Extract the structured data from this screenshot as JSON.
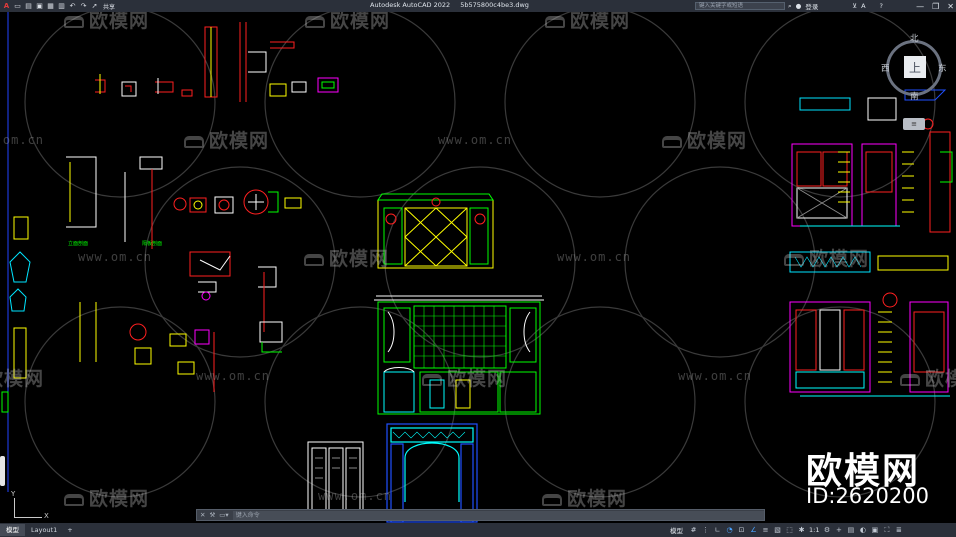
{
  "app": {
    "title": "Autodesk AutoCAD 2022",
    "filename": "5b575800c4be3.dwg",
    "share_label": "共享",
    "search_placeholder": "键入关键字或短语",
    "login_label": "登录"
  },
  "quick_access": [
    "new-icon",
    "open-icon",
    "save-icon",
    "saveas-icon",
    "print-icon",
    "undo-icon",
    "redo-icon",
    "share-icon"
  ],
  "viewcube": {
    "top": "上",
    "north": "北",
    "south": "南",
    "east": "东",
    "west": "西"
  },
  "watermark": {
    "brand": "欧模网",
    "url": "www.om.cn"
  },
  "overlay": {
    "brand": "欧模网",
    "id": "ID:2620200"
  },
  "command_line": {
    "placeholder": "键入命令"
  },
  "layout_tabs": [
    {
      "label": "模型",
      "active": true
    },
    {
      "label": "Layout1",
      "active": false
    }
  ],
  "layout_add": "+",
  "status_bar": {
    "mode": "模型",
    "scale": "1:1",
    "icons": [
      "grid-icon",
      "snap-icon",
      "ortho-icon",
      "polar-icon",
      "osnap-icon",
      "otrack-icon",
      "lineweight-icon",
      "transparency-icon",
      "selection-icon",
      "annotation-icon",
      "workspace-icon",
      "units-icon",
      "quickprops-icon",
      "isolate-icon",
      "hardware-icon",
      "fullscreen-icon",
      "customize-icon"
    ]
  },
  "colors": {
    "titlebar": "#2b303a",
    "canvas": "#000000",
    "cad_green": "#00ff00",
    "cad_yellow": "#ffff00",
    "cad_red": "#ff2020",
    "cad_magenta": "#ff00ff",
    "cad_cyan": "#00ffff",
    "cad_blue": "#2050ff"
  }
}
